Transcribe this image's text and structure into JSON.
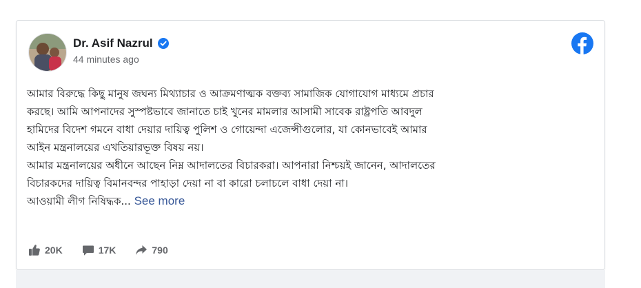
{
  "post": {
    "author": "Dr. Asif Nazrul",
    "time": "44 minutes ago",
    "lines": [
      "আমার বিরুদ্ধে কিছু মানুষ জঘন্য মিথ্যাচার ও আক্রমণাত্মক বক্তব্য সামাজিক যোগাযোগ মাধ্যমে প্রচার",
      "করছে। আমি আপনাদের সুস্পষ্টভাবে জানাতে চাই খুনের মামলার আসামী সাবেক রাষ্ট্রপতি আবদুল",
      "হামিদের বিদেশ গমনে বাধা দেয়ার দায়িত্ব পুলিশ ও গোয়েন্দা এজেন্সীগুলোর, যা কোনভাবেই আমার",
      "আইন মন্ত্রনালয়ের এখতিয়ারভূক্ত বিষয় নয়।",
      "আমার মন্ত্রনালয়ের অধীনে আছেন নিম্ন আদালতের বিচারকরা। আপনারা নিশ্চয়ই জানেন, আদালতের",
      "বিচারকদের দায়িত্ব বিমানবন্দর পাহাড়া দেয়া না বা কারো চলাচলে বাধা দেয়া না।",
      "আওয়ামী লীগ নিষিদ্ধক..."
    ],
    "see_more": "See more"
  },
  "actions": {
    "likes": "20K",
    "comments": "17K",
    "shares": "790"
  },
  "icons": {
    "brand": "facebook-logo-icon",
    "verified": "verified-badge-icon",
    "like": "thumbs-up-icon",
    "comment": "comment-icon",
    "share": "share-arrow-icon"
  },
  "colors": {
    "facebook_blue": "#1877f2",
    "link": "#385898",
    "muted": "#65676b"
  }
}
